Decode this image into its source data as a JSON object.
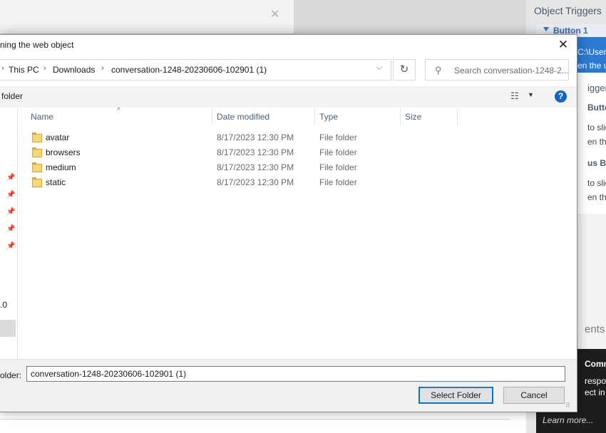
{
  "background": {
    "right_panel": {
      "title": "Object Triggers",
      "button1": "Button 1",
      "path_fragment": "C:\\Users",
      "path_fragment2": "en the u",
      "triggers_fragment": "iggers",
      "item1_title": "Button /",
      "item1_line1": "to slide",
      "item1_line2": "en the u",
      "item2_title": "us Butt",
      "item2_line1": "to slide",
      "item2_line2": "en the u",
      "comments_fragment": "ents",
      "dark_title": "Comme",
      "dark_line1": "respon",
      "dark_line2": "ect in th",
      "learn_more": "Learn more..."
    }
  },
  "dialog": {
    "title": "ning the web object",
    "close": "✕",
    "breadcrumb": [
      "This PC",
      "Downloads",
      "conversation-1248-20230606-102901 (1)"
    ],
    "search_placeholder": "Search conversation-1248-2...",
    "new_folder": "folder",
    "help": "?",
    "nav_fragment": ".0",
    "columns": {
      "name": "Name",
      "date": "Date modified",
      "type": "Type",
      "size": "Size"
    },
    "files": [
      {
        "name": "avatar",
        "date": "8/17/2023 12:30 PM",
        "type": "File folder"
      },
      {
        "name": "browsers",
        "date": "8/17/2023 12:30 PM",
        "type": "File folder"
      },
      {
        "name": "medium",
        "date": "8/17/2023 12:30 PM",
        "type": "File folder"
      },
      {
        "name": "static",
        "date": "8/17/2023 12:30 PM",
        "type": "File folder"
      }
    ],
    "folder_label": "older:",
    "folder_value": "conversation-1248-20230606-102901 (1)",
    "select_button": "Select Folder",
    "cancel_button": "Cancel"
  }
}
